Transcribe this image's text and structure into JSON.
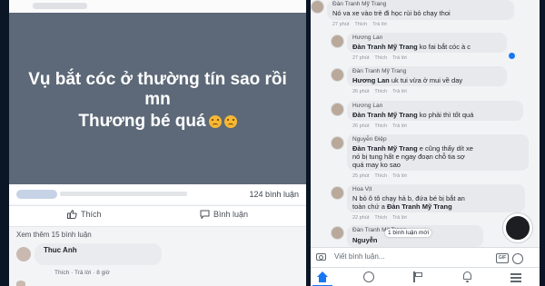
{
  "colors": {
    "post_bg": "#5d6978",
    "facebook_blue": "#1877f2"
  },
  "post": {
    "line1": "Vụ bắt cóc ở thường tín sao rồi",
    "line2": "mn",
    "line3": "Thương bé quá",
    "emoji": "sad-face-icon"
  },
  "meta": {
    "comment_count": "124 bình luận"
  },
  "actions": {
    "like": "Thích",
    "comment": "Bình luận"
  },
  "see_more": "Xem thêm 15 bình luận",
  "left_comment": {
    "name": "Thuc Anh",
    "like": "Thích",
    "reply": "Trả lời",
    "time": "8 giờ"
  },
  "right_comments": [
    {
      "name": "Đàn Tranh Mỹ Trang",
      "text": "Nó va xe vào trẻ đi học rùi bỏ chạy thoi",
      "time": "27 phút",
      "like": "Thích",
      "reply": "Trả lời"
    },
    {
      "name": "Hương Lan",
      "mention": "Đàn Tranh Mỹ Trang",
      "text": " ko fai bắt cóc à c",
      "time": "27 phút",
      "like": "Thích",
      "reply": "Trả lời"
    },
    {
      "name": "Đàn Tranh Mỹ Trang",
      "mention": "Hương Lan",
      "text": " uk tui vừa ở mui về day",
      "time": "26 phút",
      "like": "Thích",
      "reply": "Trả lời"
    },
    {
      "name": "Hương Lan",
      "mention": "Đàn Tranh Mỹ Trang",
      "text": " ko phải thì tốt quá",
      "time": "26 phút",
      "like": "Thích",
      "reply": "Trả lời"
    },
    {
      "name": "Nguyễn Điệp",
      "mention": "Đàn Tranh Mỹ Trang",
      "text": " e cũng thấy dít xe",
      "text2": "nó bị tung hất e ngay đoạn chỗ tia sợ",
      "text3": "quá may ko sao",
      "time": "25 phút",
      "like": "Thích",
      "reply": "Trả lời"
    },
    {
      "name": "Hoa Vịt",
      "text": "N bỏ ô tô chạy hả b, đứa bé bị bắt an",
      "text2_prefix": "toàn chứ a ",
      "text2_mention": "Đàn Tranh Mỹ Trang",
      "time": "22 phút",
      "like": "Thích",
      "reply": "Trả lời"
    },
    {
      "name": "Đàn Tranh Mỹ Trang",
      "text": "Nguyễn",
      "time": "",
      "like": "",
      "reply": ""
    }
  ],
  "new_comment_pill": "1 bình luận mới",
  "write_comment": {
    "placeholder": "Viết bình luận..."
  },
  "tabbar": [
    "home-icon",
    "groups-icon",
    "flag-icon",
    "bell-icon",
    "menu-icon"
  ]
}
